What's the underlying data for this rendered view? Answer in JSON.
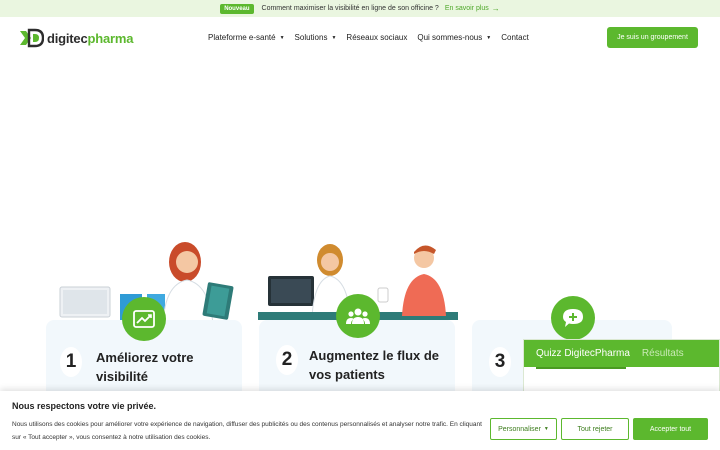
{
  "announcement": {
    "badge": "Nouveau",
    "message": "Comment maximiser la visibilité en ligne de son officine ?",
    "link": "En savoir plus",
    "link_icon": "arrow-right-icon"
  },
  "header": {
    "logo_part1": "digitec",
    "logo_part2": "pharma",
    "nav": [
      {
        "label": "Plateforme e-santé",
        "dropdown": true
      },
      {
        "label": "Solutions",
        "dropdown": true
      },
      {
        "label": "Réseaux sociaux",
        "dropdown": false
      },
      {
        "label": "Qui sommes-nous",
        "dropdown": true
      },
      {
        "label": "Contact",
        "dropdown": false
      }
    ],
    "cta": "Je suis un groupement",
    "caret": "▼"
  },
  "cards": [
    {
      "number": "1",
      "title_line1": "Améliorez votre",
      "title_line2": "visibilité",
      "icon": "chart-up-icon"
    },
    {
      "number": "2",
      "title_line1": "Augmentez le flux de",
      "title_line2": "vos patients",
      "icon": "users-icon"
    },
    {
      "number": "3",
      "title_line1": "",
      "title_line2": "",
      "icon": "chat-plus-icon"
    }
  ],
  "quiz": {
    "tab_active": "Quizz DigitecPharma",
    "tab_inactive": "Résultats"
  },
  "cookie": {
    "title": "Nous respectons votre vie privée.",
    "text": "Nous utilisons des cookies pour améliorer votre expérience de navigation, diffuser des publicités ou des contenus personnalisés et analyser notre trafic. En cliquant sur « Tout accepter », vous consentez à notre utilisation des cookies.",
    "customize": "Personnaliser",
    "reject": "Tout rejeter",
    "accept": "Accepter tout"
  },
  "colors": {
    "brand_green": "#5cb82e",
    "card_bg": "#f2f8fc"
  }
}
